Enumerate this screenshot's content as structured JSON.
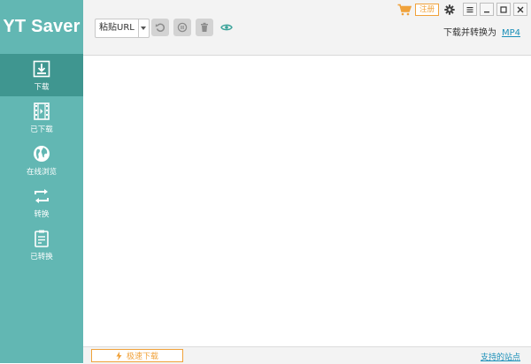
{
  "app": {
    "title": "YT Saver"
  },
  "sidebar": {
    "items": [
      {
        "label": "下载",
        "icon": "download-icon",
        "active": true
      },
      {
        "label": "已下载",
        "icon": "film-icon",
        "active": false
      },
      {
        "label": "在线浏览",
        "icon": "globe-icon",
        "active": false
      },
      {
        "label": "转换",
        "icon": "convert-icon",
        "active": false
      },
      {
        "label": "已转换",
        "icon": "converted-doc-icon",
        "active": false
      }
    ]
  },
  "toolbar": {
    "paste_label": "粘贴URL",
    "buttons": [
      "refresh-icon",
      "pause-icon",
      "trash-icon",
      "eye-icon"
    ]
  },
  "titlebar": {
    "register_label": "注册"
  },
  "convert": {
    "label": "下载并转换为",
    "format": "MP4"
  },
  "footer": {
    "turbo_label": "极速下载",
    "sites_label": "支持的站点"
  },
  "colors": {
    "sidebar": "#62b7b3",
    "sidebar_active": "#3f9690",
    "accent_orange": "#f0a23b",
    "link_blue": "#1a8fb8"
  }
}
